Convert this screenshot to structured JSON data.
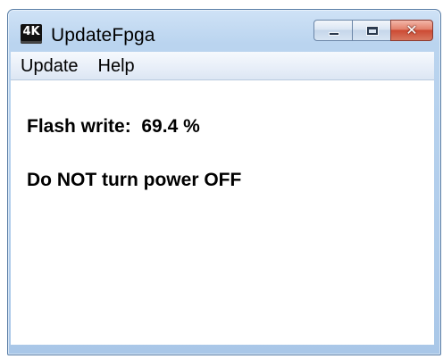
{
  "window": {
    "title": "UpdateFpga",
    "icon_label": "4K",
    "icon": "app-4k-icon",
    "caption_buttons": {
      "minimize_icon": "minimize-icon",
      "maximize_icon": "maximize-icon",
      "close_glyph": "✕"
    }
  },
  "menu": {
    "items": [
      {
        "label": "Update"
      },
      {
        "label": "Help"
      }
    ]
  },
  "content": {
    "progress_label": "Flash write:",
    "progress_value": "69.4 %",
    "progress_fraction": 0.694,
    "warning": "Do NOT turn power OFF"
  },
  "colors": {
    "close_button": "#cc4a33",
    "titlebar": "#bad4ef"
  }
}
